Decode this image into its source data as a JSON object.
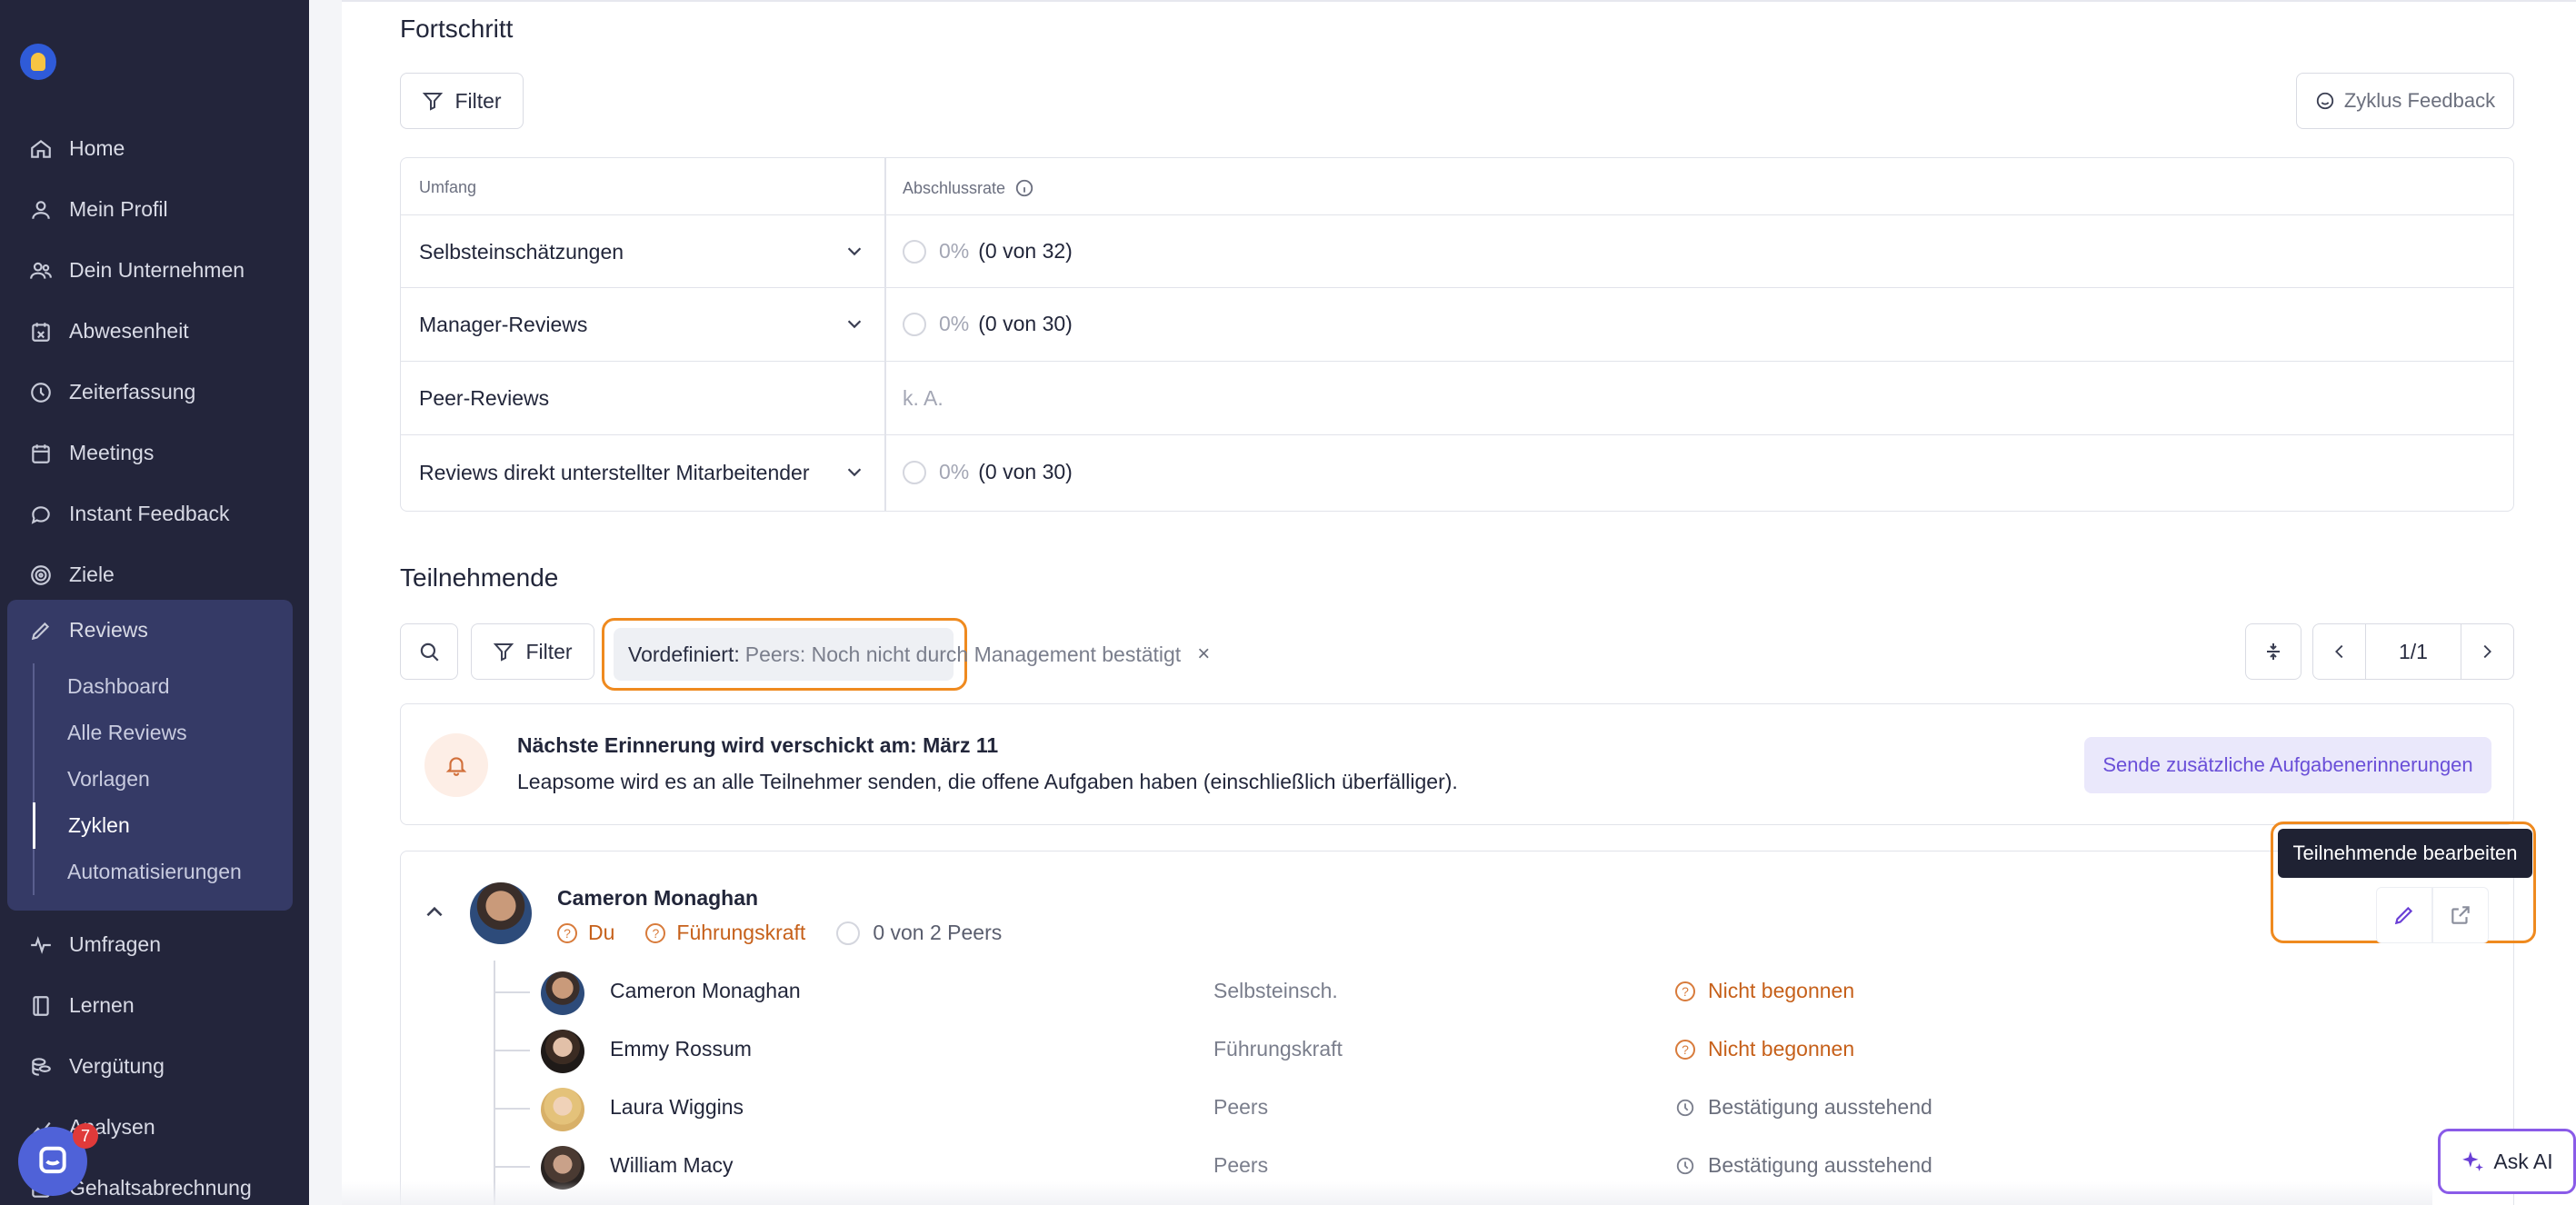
{
  "sidebar": {
    "items": [
      {
        "label": "Home",
        "icon": "home-icon"
      },
      {
        "label": "Mein Profil",
        "icon": "user-icon"
      },
      {
        "label": "Dein Unternehmen",
        "icon": "users-icon"
      },
      {
        "label": "Abwesenheit",
        "icon": "calendar-x-icon"
      },
      {
        "label": "Zeiterfassung",
        "icon": "clock-icon"
      },
      {
        "label": "Meetings",
        "icon": "calendar-icon"
      },
      {
        "label": "Instant Feedback",
        "icon": "chat-icon"
      },
      {
        "label": "Ziele",
        "icon": "target-icon"
      }
    ],
    "reviews": {
      "label": "Reviews",
      "icon": "pencil-icon",
      "sub": [
        "Dashboard",
        "Alle Reviews",
        "Vorlagen",
        "Zyklen",
        "Automatisierungen"
      ],
      "active": "Zyklen"
    },
    "bottom": [
      {
        "label": "Umfragen",
        "icon": "pulse-icon"
      },
      {
        "label": "Lernen",
        "icon": "book-icon"
      },
      {
        "label": "Vergütung",
        "icon": "coins-icon"
      },
      {
        "label": "Analysen",
        "icon": "chart-icon"
      },
      {
        "label": "Gehaltsabrechnung",
        "icon": "payroll-icon"
      }
    ],
    "chat_badge": "7"
  },
  "progress": {
    "title": "Fortschritt",
    "filter_label": "Filter",
    "cycle_feedback_label": "Zyklus Feedback",
    "col_scope": "Umfang",
    "col_rate": "Abschlussrate",
    "rows": [
      {
        "label": "Selbsteinschätzungen",
        "pct": "0%",
        "count": "(0 von 32)"
      },
      {
        "label": "Manager-Reviews",
        "pct": "0%",
        "count": "(0 von 30)"
      },
      {
        "label": "Peer-Reviews",
        "na": "k. A."
      },
      {
        "label": "Reviews direkt unterstellter Mitarbeitender",
        "pct": "0%",
        "count": "(0 von 30)"
      }
    ]
  },
  "participants": {
    "title": "Teilnehmende",
    "filter_label": "Filter",
    "chip_prefix": "Vordefiniert:",
    "chip_value": "Peers: Noch nicht durch Management bestätigt",
    "chip_close": "×",
    "pagination": "1/1",
    "reminder_title": "Nächste Erinnerung wird verschickt am: März 11",
    "reminder_text": "Leapsome wird es an alle Teilnehmer senden, die offene Aufgaben haben (einschließlich überfälliger).",
    "reminder_button": "Sende zusätzliche Aufgabenerinnerungen",
    "tooltip": "Teilnehmende bearbeiten",
    "person": {
      "name": "Cameron Monaghan",
      "status_self": "Du",
      "status_manager": "Führungskraft",
      "status_peers": "0 von 2 Peers"
    },
    "reviewers": [
      {
        "name": "Cameron Monaghan",
        "role": "Selbsteinsch.",
        "status": "Nicht begonnen"
      },
      {
        "name": "Emmy Rossum",
        "role": "Führungskraft",
        "status": "Nicht begonnen"
      },
      {
        "name": "Laura Wiggins",
        "role": "Peers",
        "status": "Bestätigung ausstehend"
      },
      {
        "name": "William Macy",
        "role": "Peers",
        "status": "Bestätigung ausstehend"
      }
    ]
  },
  "ask_ai": "Ask AI",
  "colors": {
    "sidebar": "#23253b",
    "accent": "#6a4fd8",
    "warning": "#c6601a",
    "highlight": "#ef8a1f"
  }
}
